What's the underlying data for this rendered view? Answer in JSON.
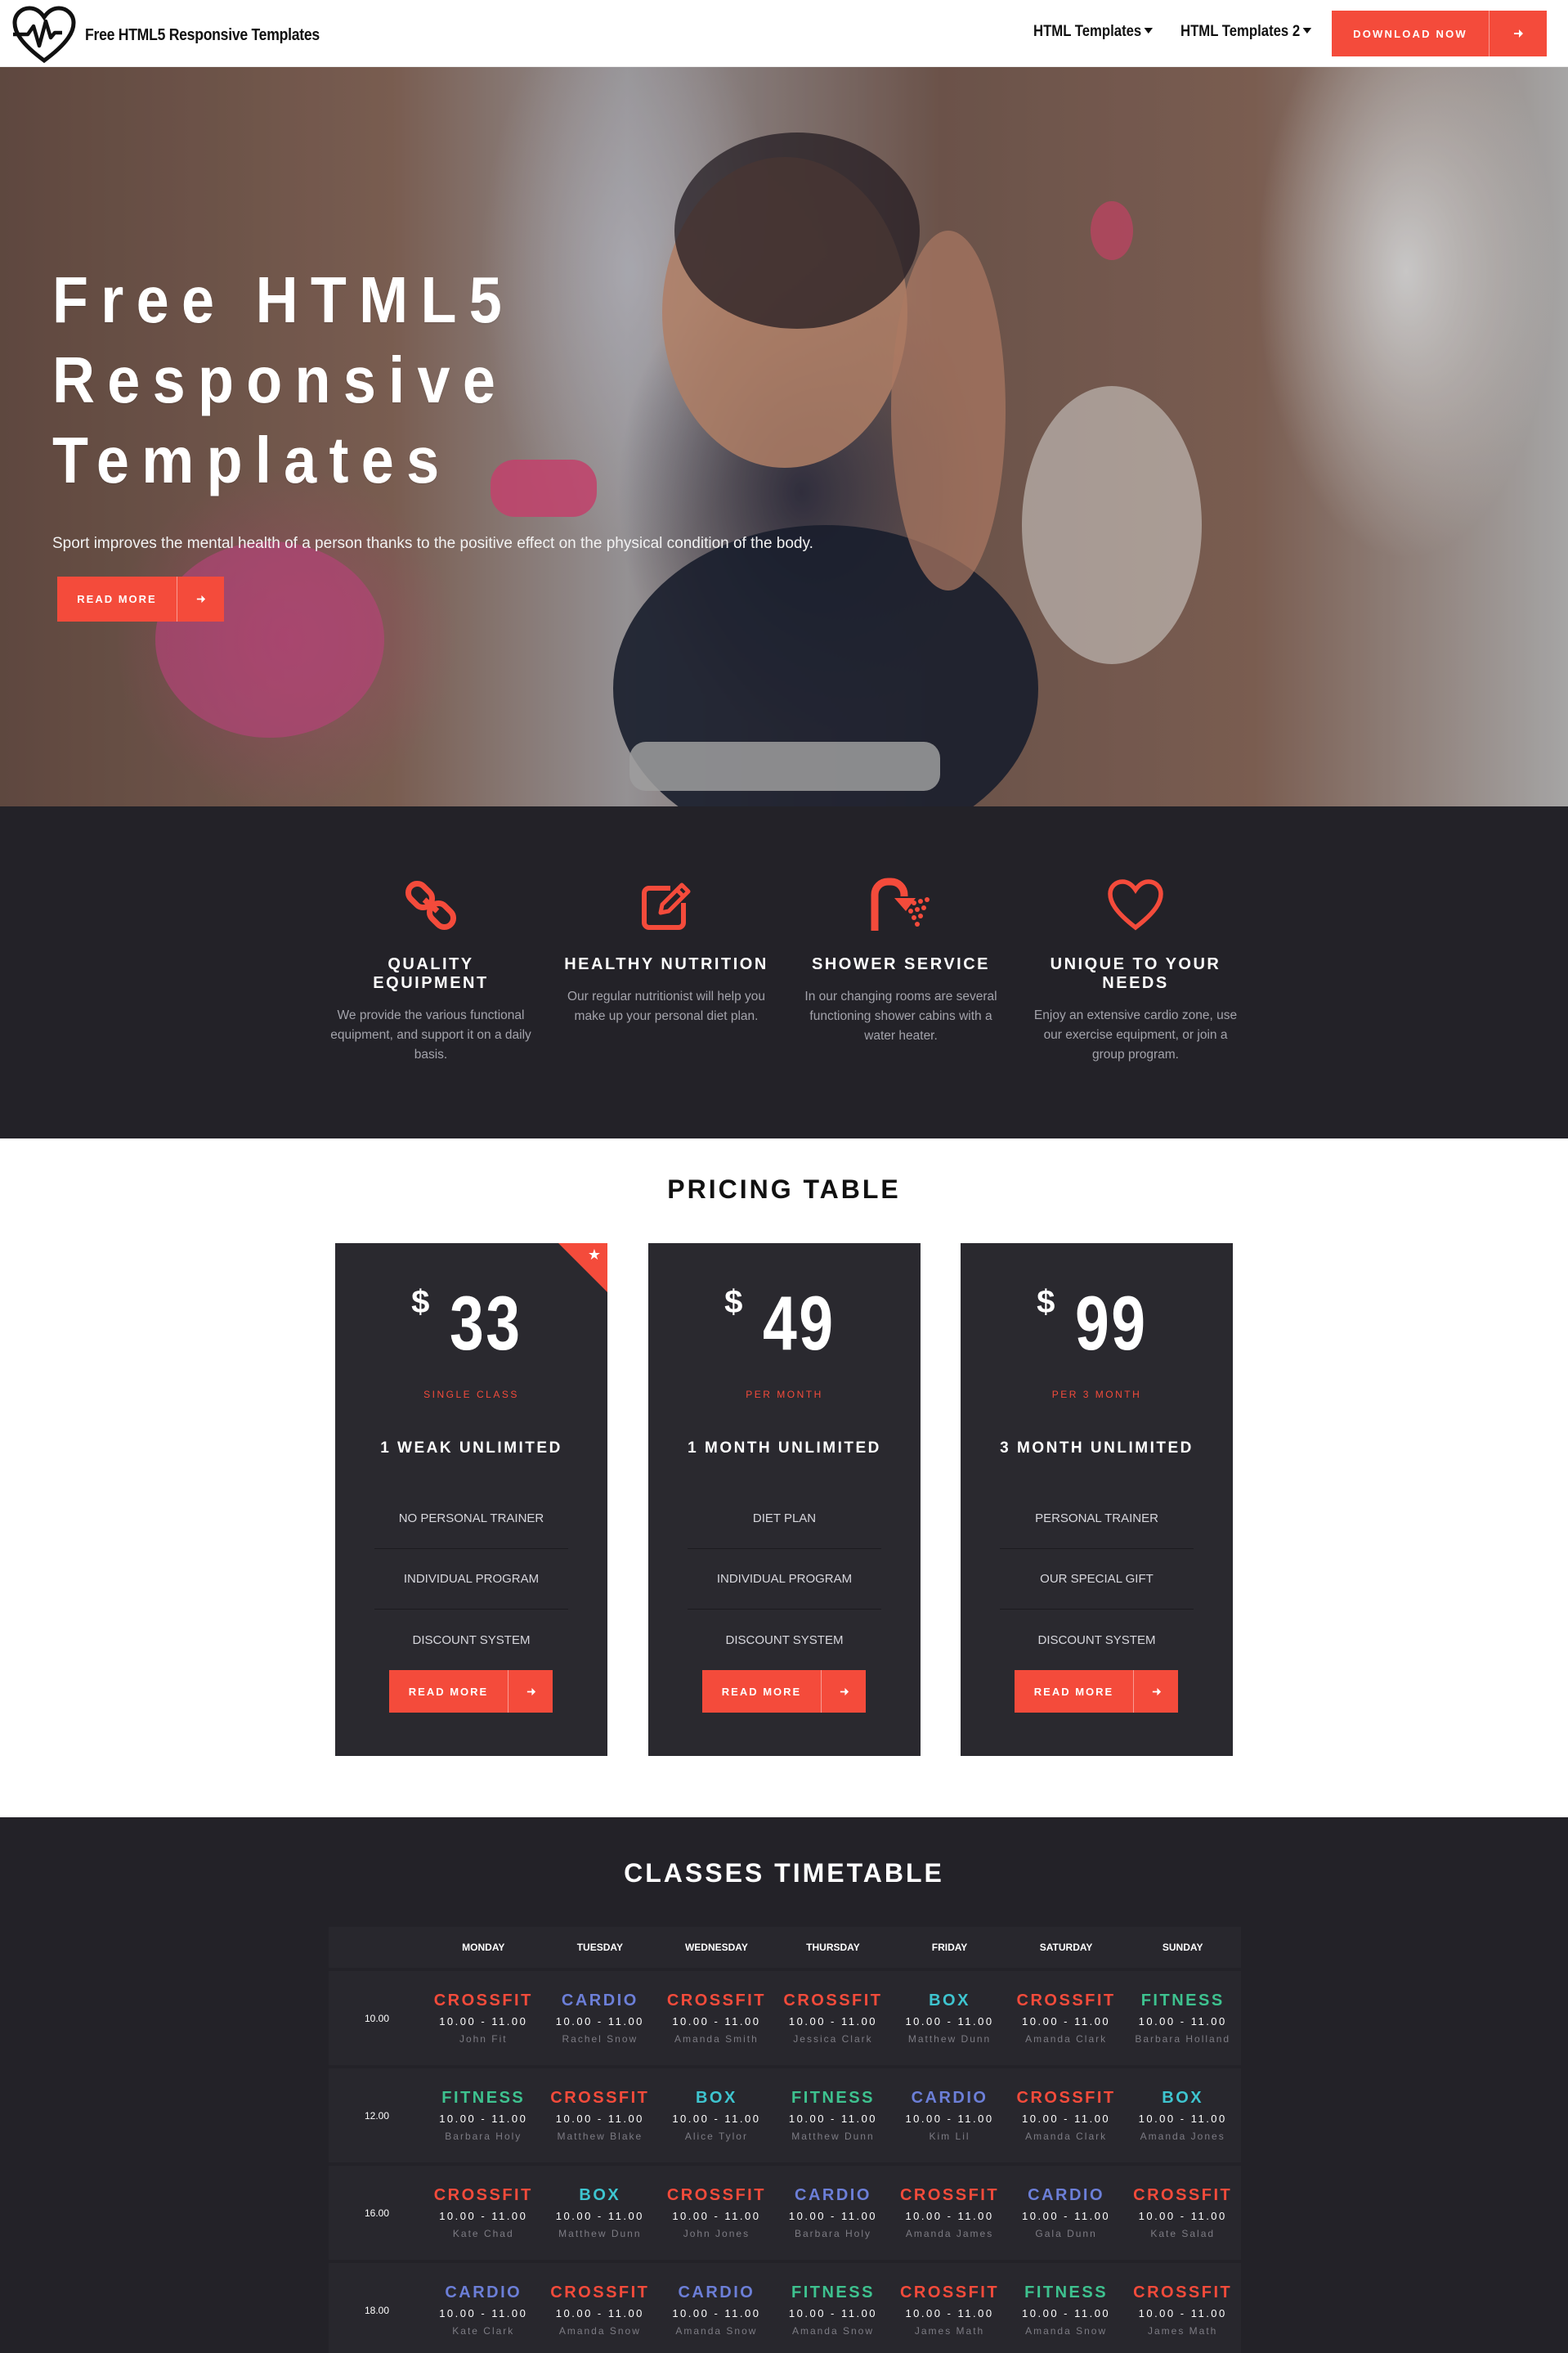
{
  "nav": {
    "brand": "Free HTML5 Responsive Templates",
    "menu1": "HTML Templates",
    "menu2": "HTML Templates 2",
    "download": "DOWNLOAD NOW"
  },
  "colors": {
    "accent": "#f44b3b",
    "dark": "#232228",
    "card": "#2a292f",
    "cardio": "#6c7fd8",
    "box": "#3ec5d0",
    "fitness": "#3ec28f"
  },
  "hero": {
    "title_lines": [
      "Free HTML5",
      "Responsive",
      "Templates"
    ],
    "subtitle": "Sport improves the mental health of a person thanks to the positive effect on the physical condition of the body.",
    "button": "READ MORE"
  },
  "features": [
    {
      "icon": "chain-link-icon",
      "title": "QUALITY EQUIPMENT",
      "text": "We provide the various functional equipment, and support it on a daily basis."
    },
    {
      "icon": "edit-icon",
      "title": "HEALTHY NUTRITION",
      "text": "Our regular nutritionist will help you make up your personal diet plan."
    },
    {
      "icon": "shower-icon",
      "title": "SHOWER SERVICE",
      "text": "In our changing rooms are several functioning shower cabins with a water heater."
    },
    {
      "icon": "heart-icon",
      "title": "UNIQUE TO YOUR NEEDS",
      "text": "Enjoy an extensive cardio zone, use our exercise equipment, or join a group program."
    }
  ],
  "pricing": {
    "title": "PRICING TABLE",
    "currency": "$",
    "plans": [
      {
        "price": "33",
        "period": "SINGLE CLASS",
        "name": "1 WEAK UNLIMITED",
        "items": [
          "NO PERSONAL TRAINER",
          "INDIVIDUAL PROGRAM",
          "DISCOUNT SYSTEM"
        ],
        "button": "READ MORE",
        "featured": true
      },
      {
        "price": "49",
        "period": "PER MONTH",
        "name": "1 MONTH UNLIMITED",
        "items": [
          "DIET PLAN",
          "INDIVIDUAL PROGRAM",
          "DISCOUNT SYSTEM"
        ],
        "button": "READ MORE"
      },
      {
        "price": "99",
        "period": "PER 3 MONTH",
        "name": "3 MONTH UNLIMITED",
        "items": [
          "PERSONAL TRAINER",
          "OUR SPECIAL GIFT",
          "DISCOUNT SYSTEM"
        ],
        "button": "READ MORE"
      }
    ]
  },
  "timetable": {
    "title": "CLASSES TIMETABLE",
    "days": [
      "MONDAY",
      "TUESDAY",
      "WEDNESDAY",
      "THURSDAY",
      "FRIDAY",
      "SATURDAY",
      "SUNDAY"
    ],
    "rows": [
      {
        "time": "10.00",
        "cells": [
          {
            "cls": "CROSSFIT",
            "hrs": "10.00 - 11.00",
            "trainer": "John Fit"
          },
          {
            "cls": "CARDIO",
            "hrs": "10.00 - 11.00",
            "trainer": "Rachel Snow"
          },
          {
            "cls": "CROSSFIT",
            "hrs": "10.00 - 11.00",
            "trainer": "Amanda Smith"
          },
          {
            "cls": "CROSSFIT",
            "hrs": "10.00 - 11.00",
            "trainer": "Jessica Clark"
          },
          {
            "cls": "BOX",
            "hrs": "10.00 - 11.00",
            "trainer": "Matthew Dunn"
          },
          {
            "cls": "CROSSFIT",
            "hrs": "10.00 - 11.00",
            "trainer": "Amanda Clark"
          },
          {
            "cls": "FITNESS",
            "hrs": "10.00 - 11.00",
            "trainer": "Barbara Holland"
          }
        ]
      },
      {
        "time": "12.00",
        "cells": [
          {
            "cls": "FITNESS",
            "hrs": "10.00 - 11.00",
            "trainer": "Barbara Holy"
          },
          {
            "cls": "CROSSFIT",
            "hrs": "10.00 - 11.00",
            "trainer": "Matthew Blake"
          },
          {
            "cls": "BOX",
            "hrs": "10.00 - 11.00",
            "trainer": "Alice Tylor"
          },
          {
            "cls": "FITNESS",
            "hrs": "10.00 - 11.00",
            "trainer": "Matthew Dunn"
          },
          {
            "cls": "CARDIO",
            "hrs": "10.00 - 11.00",
            "trainer": "Kim Lil"
          },
          {
            "cls": "CROSSFIT",
            "hrs": "10.00 - 11.00",
            "trainer": "Amanda Clark"
          },
          {
            "cls": "BOX",
            "hrs": "10.00 - 11.00",
            "trainer": "Amanda Jones"
          }
        ]
      },
      {
        "time": "16.00",
        "cells": [
          {
            "cls": "CROSSFIT",
            "hrs": "10.00 - 11.00",
            "trainer": "Kate Chad"
          },
          {
            "cls": "BOX",
            "hrs": "10.00 - 11.00",
            "trainer": "Matthew Dunn"
          },
          {
            "cls": "CROSSFIT",
            "hrs": "10.00 - 11.00",
            "trainer": "John Jones"
          },
          {
            "cls": "CARDIO",
            "hrs": "10.00 - 11.00",
            "trainer": "Barbara Holy"
          },
          {
            "cls": "CROSSFIT",
            "hrs": "10.00 - 11.00",
            "trainer": "Amanda James"
          },
          {
            "cls": "CARDIO",
            "hrs": "10.00 - 11.00",
            "trainer": "Gala Dunn"
          },
          {
            "cls": "CROSSFIT",
            "hrs": "10.00 - 11.00",
            "trainer": "Kate Salad"
          }
        ]
      },
      {
        "time": "18.00",
        "cells": [
          {
            "cls": "CARDIO",
            "hrs": "10.00 - 11.00",
            "trainer": "Kate Clark"
          },
          {
            "cls": "CROSSFIT",
            "hrs": "10.00 - 11.00",
            "trainer": "Amanda Snow"
          },
          {
            "cls": "CARDIO",
            "hrs": "10.00 - 11.00",
            "trainer": "Amanda Snow"
          },
          {
            "cls": "FITNESS",
            "hrs": "10.00 - 11.00",
            "trainer": "Amanda Snow"
          },
          {
            "cls": "CROSSFIT",
            "hrs": "10.00 - 11.00",
            "trainer": "James Math"
          },
          {
            "cls": "FITNESS",
            "hrs": "10.00 - 11.00",
            "trainer": "Amanda Snow"
          },
          {
            "cls": "CROSSFIT",
            "hrs": "10.00 - 11.00",
            "trainer": "James Math"
          }
        ]
      }
    ]
  }
}
